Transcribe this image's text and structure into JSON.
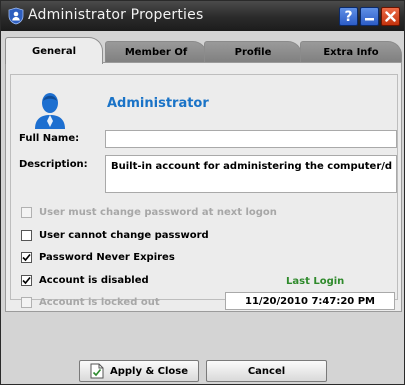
{
  "window": {
    "title": "Administrator Properties",
    "title_icon": "shield-user-icon",
    "help_label": "?"
  },
  "tabs": [
    {
      "label": "General",
      "active": true
    },
    {
      "label": "Member Of",
      "active": false
    },
    {
      "label": "Profile",
      "active": false
    },
    {
      "label": "Extra Info",
      "active": false
    }
  ],
  "general": {
    "user_name": "Administrator",
    "user_icon": "user-avatar-icon",
    "full_name_label": "Full Name:",
    "full_name_value": "",
    "description_label": "Description:",
    "description_value": "Built-in account for administering the computer/domain",
    "checkboxes": [
      {
        "label": "User must change password at next logon",
        "checked": false,
        "enabled": false
      },
      {
        "label": "User cannot change password",
        "checked": false,
        "enabled": true
      },
      {
        "label": "Password Never Expires",
        "checked": true,
        "enabled": true
      },
      {
        "label": "Account is disabled",
        "checked": true,
        "enabled": true
      },
      {
        "label": "Account is locked out",
        "checked": false,
        "enabled": false
      }
    ],
    "last_login_label": "Last Login",
    "last_login_value": "11/20/2010 7:47:20 PM"
  },
  "buttons": {
    "apply_close": "Apply & Close",
    "apply_close_icon": "document-check-icon",
    "cancel": "Cancel"
  },
  "colors": {
    "accent_blue": "#1a73c7",
    "last_login_green": "#2f8a2c",
    "close_red": "#c3330d"
  }
}
